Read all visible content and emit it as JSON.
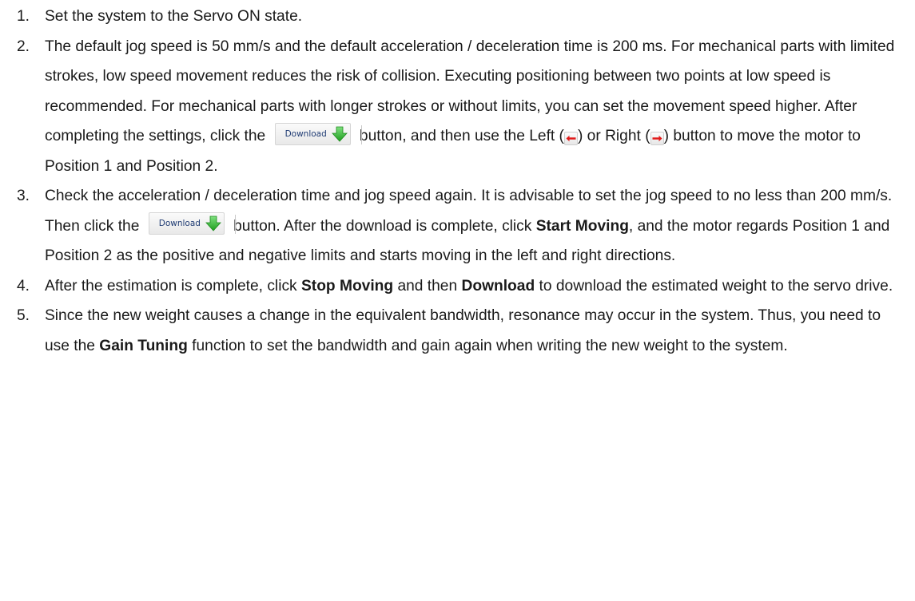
{
  "colors": {
    "text": "#1a1a1a",
    "download_label": "#1f3b73",
    "download_arrow": "#2db82d",
    "jog_arrow": "#e21b1b"
  },
  "icons": {
    "download": "down-arrow-icon",
    "jog_left": "left-arrow-icon",
    "jog_right": "right-arrow-icon"
  },
  "download_button_label": "Download",
  "steps": [
    {
      "number": "1.",
      "text": "Set the system to the Servo ON state."
    },
    {
      "number": "2.",
      "part1": "The default jog speed is 50 mm/s and the default acceleration / deceleration time is 200 ms. For mechanical parts with limited strokes, low speed movement reduces the risk of collision. Executing positioning between two points at low speed is recommended. For mechanical parts with longer strokes or without limits, you can set the movement speed higher. After completing the settings, click the",
      "part2": "button, and then use the Left (",
      "part3": ") or Right (",
      "part4": ") button to move the motor to Position 1 and Position 2."
    },
    {
      "number": "3.",
      "part1": "Check the acceleration / deceleration time and jog speed again. It is advisable to set the jog speed to no less than 200 mm/s. Then click the",
      "part2": "button. After the download is complete, click",
      "bold1": "Start Moving",
      "part3": ", and the motor regards Position 1 and Position 2 as the positive and negative limits and starts moving in the left and right directions."
    },
    {
      "number": "4.",
      "part1": "After the estimation is complete, click",
      "bold1": "Stop Moving",
      "part2": "and then",
      "bold2": "Download",
      "part3": "to download the estimated weight to the servo drive."
    },
    {
      "number": "5.",
      "part1": "Since the new weight causes a change in the equivalent bandwidth, resonance may occur in the system. Thus, you need to use the",
      "bold1": "Gain Tuning",
      "part2": "function to set the bandwidth and gain again when writing the new weight to the system."
    }
  ]
}
